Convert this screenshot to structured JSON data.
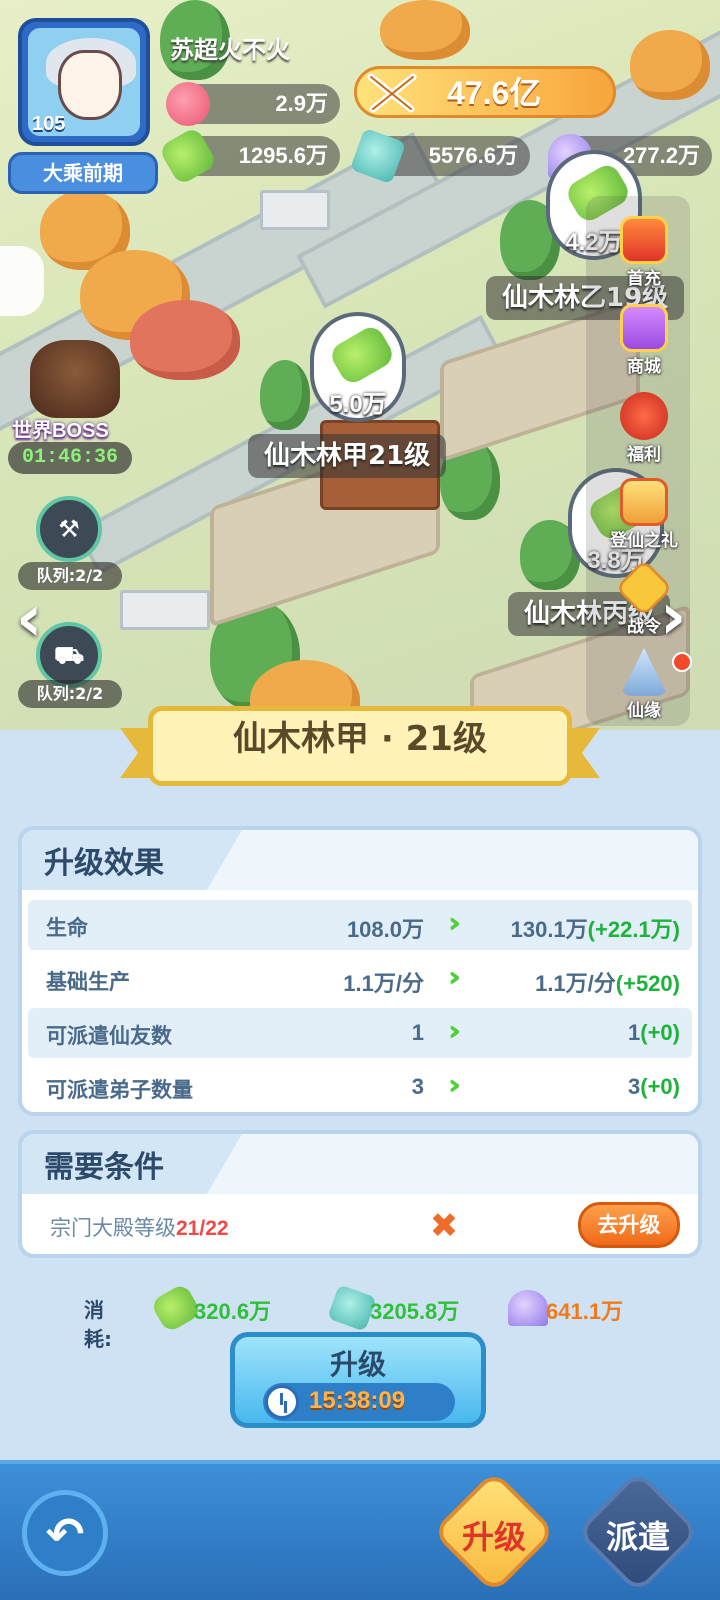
{
  "player": {
    "name": "苏超火不火",
    "level": "105",
    "realm": "大乘前期"
  },
  "resources": {
    "peach": "2.9万",
    "power": "47.6亿",
    "wood": "1295.6万",
    "stone": "5576.6万",
    "crystal": "277.2万"
  },
  "map": {
    "buildings": [
      {
        "label": "仙木林甲21级",
        "yield": "5.0万"
      },
      {
        "label": "仙木林乙19级",
        "yield": "4.2万"
      },
      {
        "label": "仙木林丙级",
        "yield": "3.8万"
      }
    ],
    "boss": {
      "title": "世界BOSS",
      "timer": "01:46:36"
    },
    "queues": [
      {
        "label": "队列:2/2"
      },
      {
        "label": "队列:2/2"
      }
    ]
  },
  "right_menu": [
    {
      "label": "首充",
      "icon": "first-recharge-icon"
    },
    {
      "label": "商城",
      "icon": "gift-shop-icon"
    },
    {
      "label": "福利",
      "icon": "red-pouch-icon"
    },
    {
      "label": "登仙之礼",
      "icon": "gift-box-icon"
    },
    {
      "label": "战令",
      "icon": "battle-pass-icon"
    },
    {
      "label": "仙缘",
      "icon": "mountain-icon"
    }
  ],
  "panel": {
    "title": "仙木林甲 · 21级",
    "effects_title": "升级效果",
    "effects": [
      {
        "label": "生命",
        "current": "108.0万",
        "next": "130.1万",
        "delta": "(+22.1万)"
      },
      {
        "label": "基础生产",
        "current": "1.1万/分",
        "next": "1.1万/分",
        "delta": "(+520)"
      },
      {
        "label": "可派遣仙友数",
        "current": "1",
        "next": "1",
        "delta": "(+0)"
      },
      {
        "label": "可派遣弟子数量",
        "current": "3",
        "next": "3",
        "delta": "(+0)"
      }
    ],
    "requirements_title": "需要条件",
    "requirement": {
      "label": "宗门大殿等级",
      "progress": "21/22",
      "action": "去升级"
    },
    "cost_label": "消耗:",
    "costs": [
      {
        "icon": "wood-icon",
        "value": "320.6万",
        "color": "#2fbf3a"
      },
      {
        "icon": "stone-icon",
        "value": "3205.8万",
        "color": "#2fbf3a"
      },
      {
        "icon": "crystal-icon",
        "value": "641.1万",
        "color": "#f07a1a"
      }
    ],
    "upgrade_button": {
      "label": "升级",
      "timer": "15:38:09"
    }
  },
  "bottom_nav": {
    "upgrade_tab": "升级",
    "dispatch_tab": "派遣"
  }
}
